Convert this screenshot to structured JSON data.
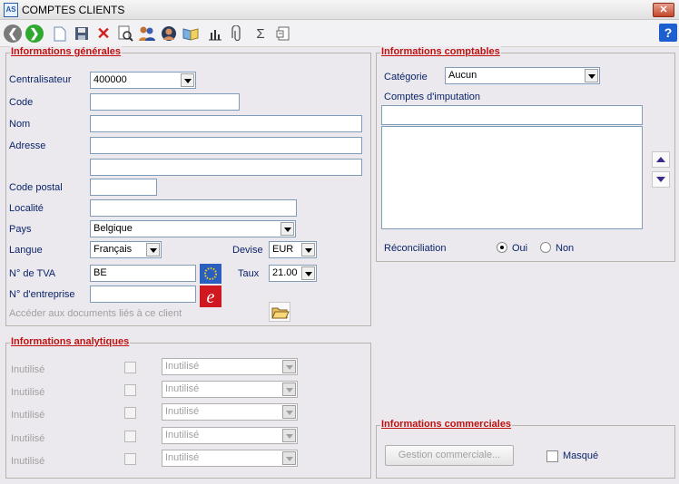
{
  "window": {
    "title": "COMPTES CLIENTS",
    "close_label": "✕",
    "app_icon_text": "AS"
  },
  "toolbar": {
    "icons": [
      "back-icon",
      "forward-icon",
      "new-document-icon",
      "save-icon",
      "delete-icon",
      "search-icon",
      "users-icon",
      "contact-icon",
      "book-icon",
      "chart-icon",
      "attachment-icon",
      "sum-icon",
      "export-icon"
    ],
    "help_label": "?"
  },
  "general": {
    "title": "Informations générales",
    "centralisateur_label": "Centralisateur",
    "centralisateur_value": "400000",
    "code_label": "Code",
    "code_value": "",
    "nom_label": "Nom",
    "nom_value": "",
    "adresse_label": "Adresse",
    "adresse_value": "",
    "adresse2_value": "",
    "code_postal_label": "Code postal",
    "code_postal_value": "",
    "localite_label": "Localité",
    "localite_value": "",
    "pays_label": "Pays",
    "pays_value": "Belgique",
    "langue_label": "Langue",
    "langue_value": "Français",
    "devise_label": "Devise",
    "devise_value": "EUR",
    "tva_label": "N° de TVA",
    "tva_value": "BE",
    "taux_label": "Taux",
    "taux_value": "21.00",
    "entreprise_label": "N° d'entreprise",
    "entreprise_value": "",
    "documents_label": "Accéder aux documents liés à ce client"
  },
  "analytiques": {
    "title": "Informations analytiques",
    "rows": [
      {
        "label": "Inutilisé",
        "select": "Inutilisé"
      },
      {
        "label": "Inutilisé",
        "select": "Inutilisé"
      },
      {
        "label": "Inutilisé",
        "select": "Inutilisé"
      },
      {
        "label": "Inutilisé",
        "select": "Inutilisé"
      },
      {
        "label": "Inutilisé",
        "select": "Inutilisé"
      }
    ]
  },
  "comptables": {
    "title": "Informations comptables",
    "categorie_label": "Catégorie",
    "categorie_value": "Aucun",
    "comptes_label": "Comptes d'imputation",
    "comptes_value": "",
    "reconciliation_label": "Réconciliation",
    "oui_label": "Oui",
    "non_label": "Non",
    "reconciliation_selected": "Oui"
  },
  "commerciales": {
    "title": "Informations commerciales",
    "gestion_button": "Gestion commerciale...",
    "masque_label": "Masqué"
  }
}
